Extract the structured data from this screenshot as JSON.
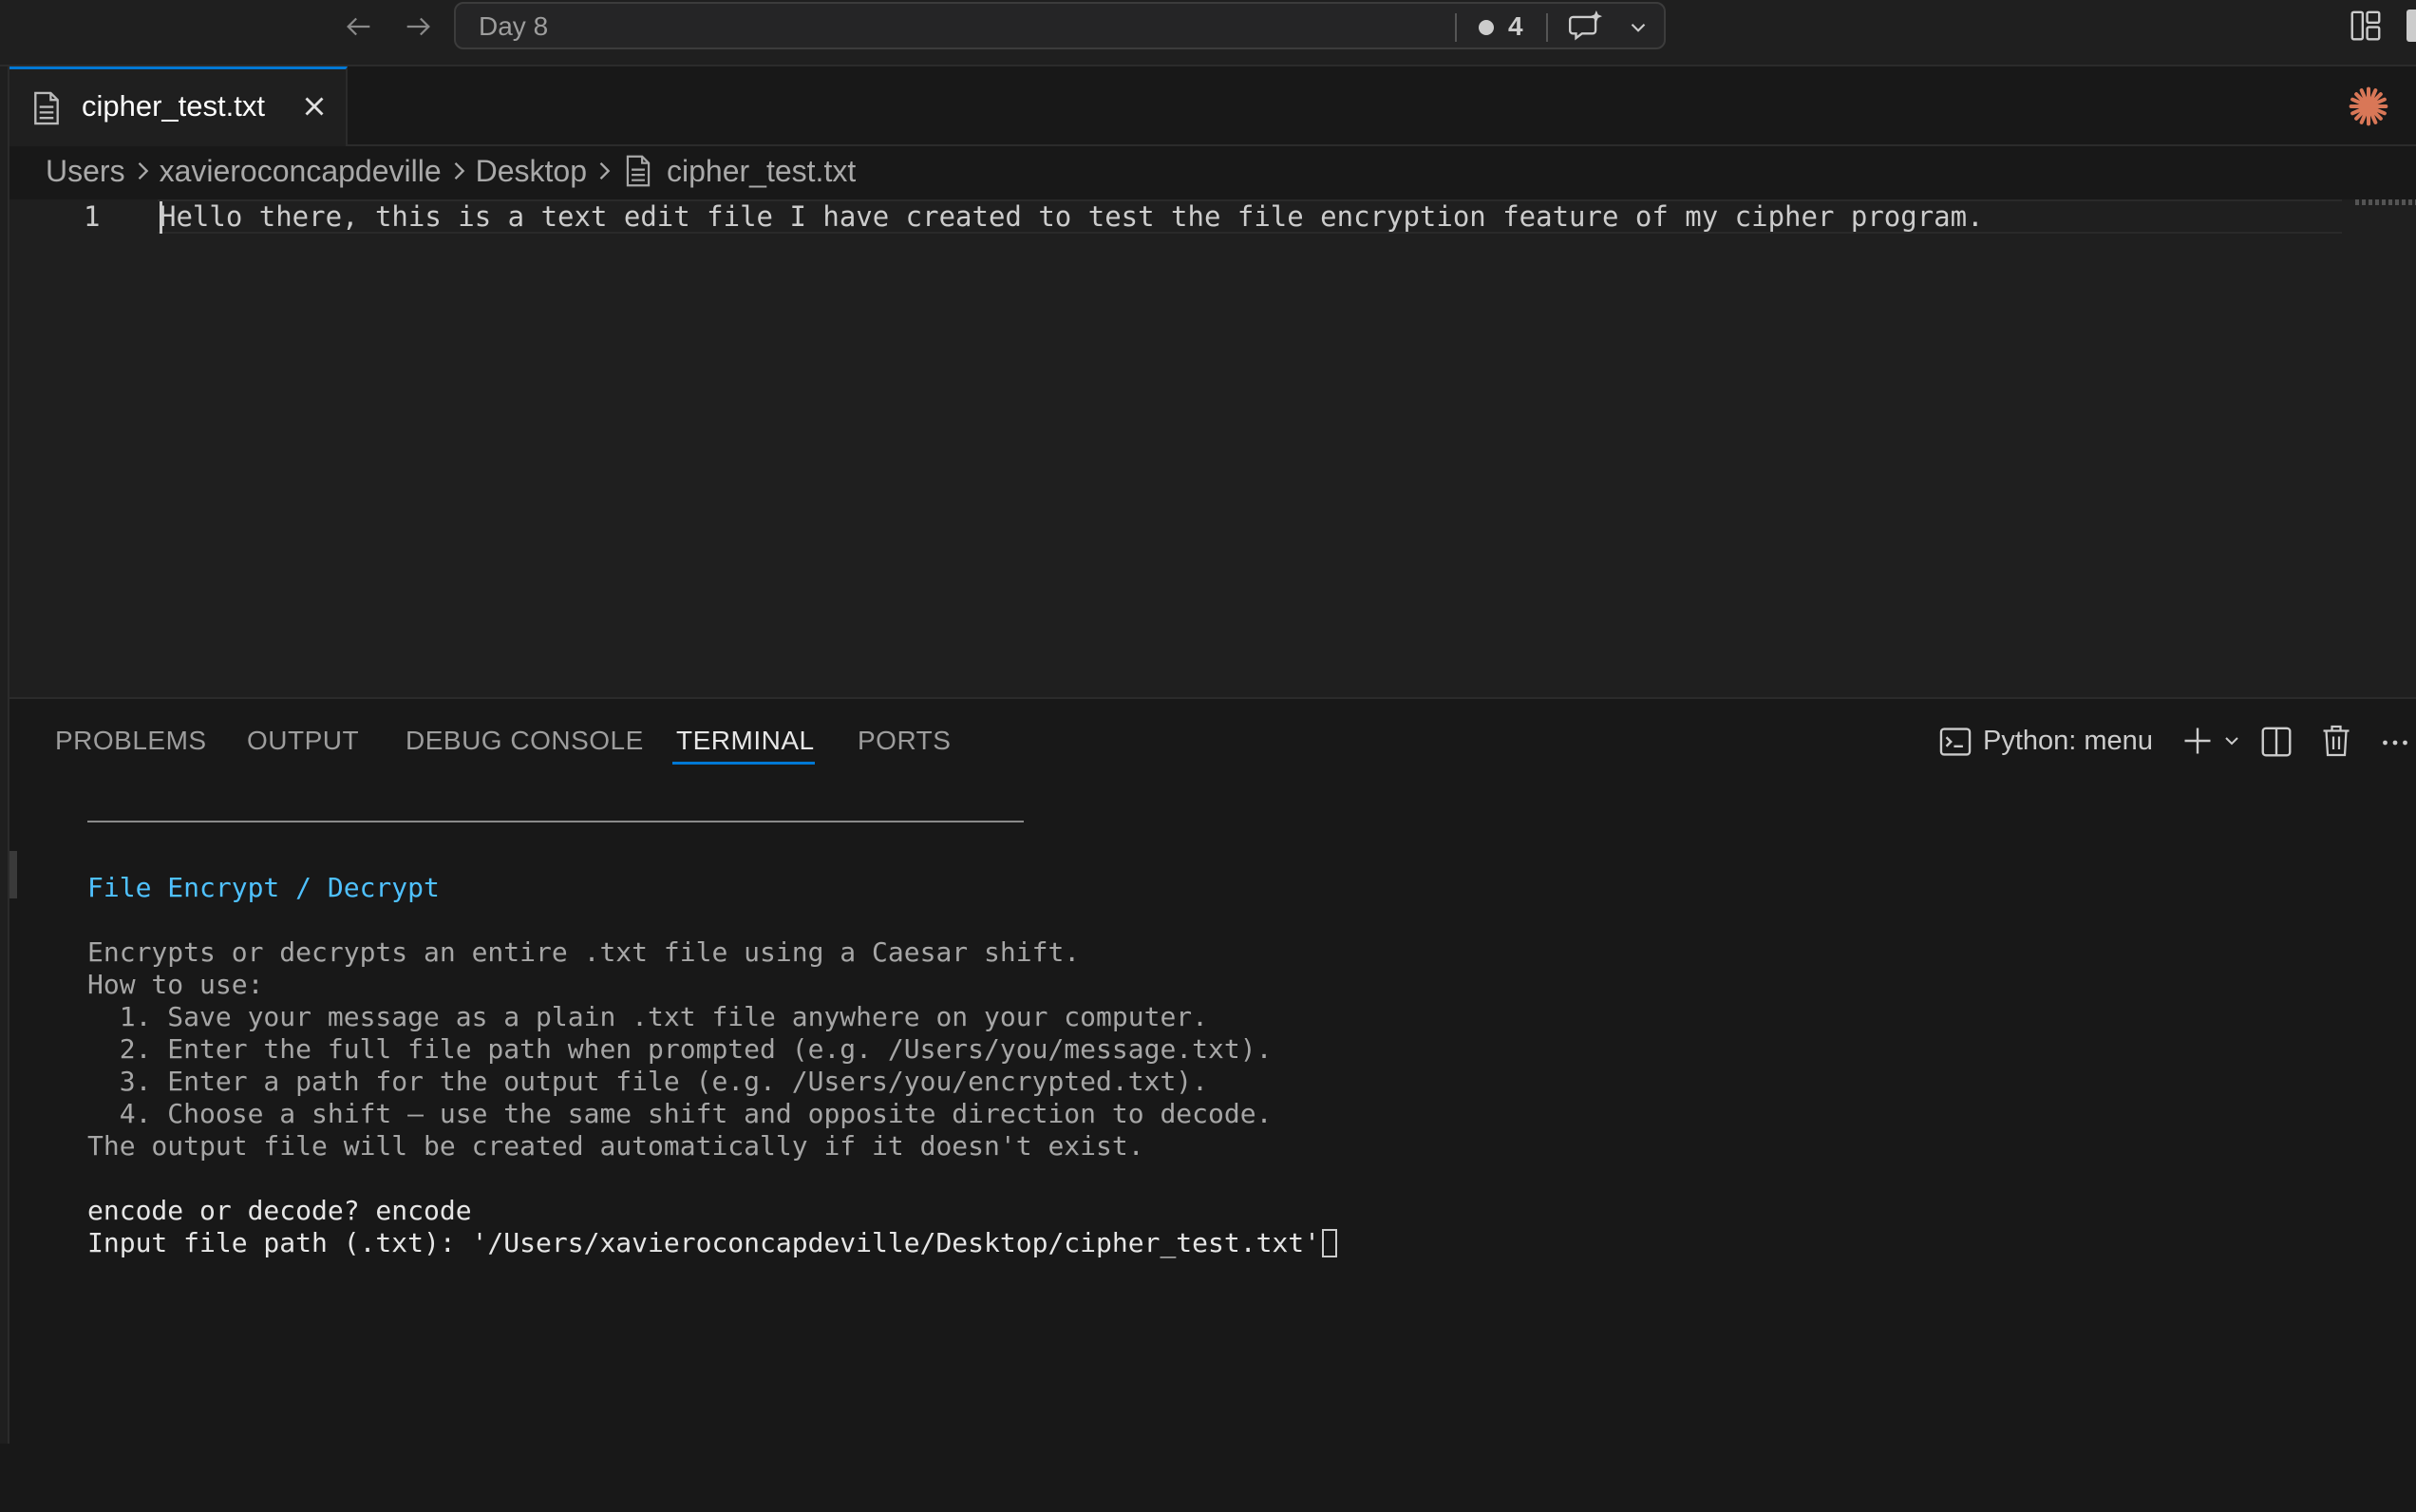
{
  "titlebar": {
    "search_title": "Day 8",
    "dirty_count": "4"
  },
  "tabs": [
    {
      "label": "cipher_test.txt",
      "active": true
    }
  ],
  "breadcrumb": {
    "items": [
      "Users",
      "xavieroconcapdeville",
      "Desktop",
      "cipher_test.txt"
    ]
  },
  "editor": {
    "line_number": "1",
    "line_text": "Hello there, this is a text edit file I have created to test the file encryption feature of my cipher program."
  },
  "panel": {
    "tabs": [
      "PROBLEMS",
      "OUTPUT",
      "DEBUG CONSOLE",
      "TERMINAL",
      "PORTS"
    ],
    "active_tab": "TERMINAL",
    "shell_label": "Python: menu"
  },
  "terminal": {
    "heading": "File Encrypt / Decrypt",
    "description": "Encrypts or decrypts an entire .txt file using a Caesar shift.",
    "how_to": "How to use:",
    "steps": [
      "  1. Save your message as a plain .txt file anywhere on your computer.",
      "  2. Enter the full file path when prompted (e.g. /Users/you/message.txt).",
      "  3. Enter a path for the output file (e.g. /Users/you/encrypted.txt).",
      "  4. Choose a shift — use the same shift and opposite direction to decode."
    ],
    "note": "The output file will be created automatically if it doesn't exist.",
    "prompt_mode": "encode or decode? encode",
    "prompt_input": "Input file path (.txt): '/Users/xavieroconcapdeville/Desktop/cipher_test.txt'"
  },
  "colors": {
    "accent": "#0078d4",
    "terminal_heading": "#4fc1ff",
    "background": "#181818"
  }
}
